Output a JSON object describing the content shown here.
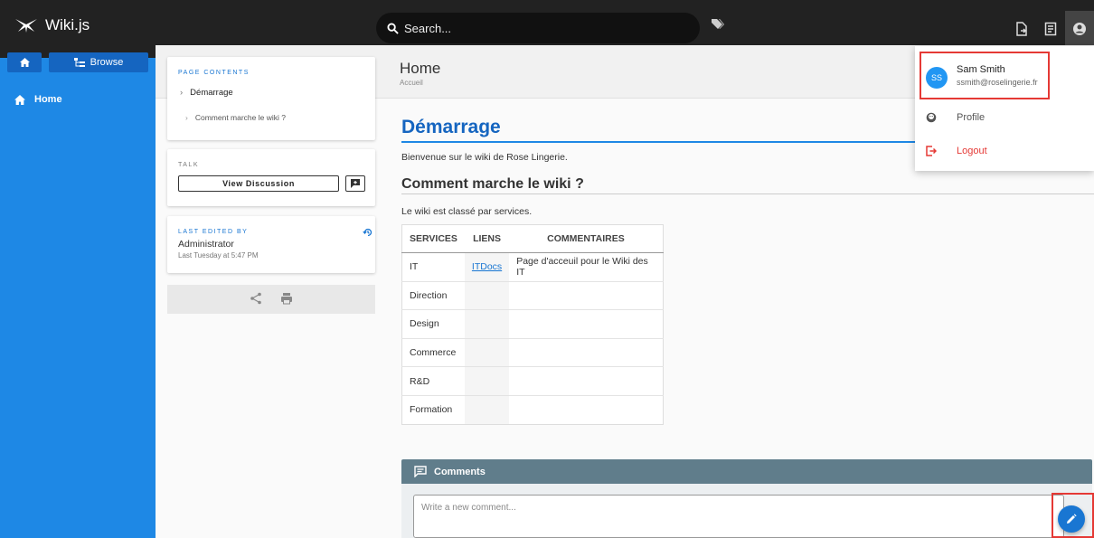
{
  "app": {
    "name": "Wiki.js"
  },
  "search": {
    "placeholder": "Search..."
  },
  "sidebar": {
    "browse_label": "Browse",
    "items": [
      {
        "label": "Home"
      }
    ]
  },
  "toc": {
    "label": "PAGE CONTENTS",
    "items": [
      {
        "label": "Démarrage",
        "level": 1
      },
      {
        "label": "Comment marche le wiki ?",
        "level": 2
      }
    ]
  },
  "talk": {
    "label": "TALK",
    "button": "View Discussion"
  },
  "last_edited": {
    "label": "LAST EDITED BY",
    "author": "Administrator",
    "when": "Last Tuesday at 5:47 PM"
  },
  "page": {
    "title": "Home",
    "subtitle": "Accueil",
    "h1": "Démarrage",
    "intro": "Bienvenue sur le wiki de Rose Lingerie.",
    "h2": "Comment marche le wiki ?",
    "p2": "Le wiki est classé par services."
  },
  "table": {
    "headers": [
      "SERVICES",
      "LIENS",
      "COMMENTAIRES"
    ],
    "rows": [
      [
        "IT",
        "ITDocs",
        "Page d'acceuil pour le Wiki des IT"
      ],
      [
        "Direction",
        "",
        ""
      ],
      [
        "Design",
        "",
        ""
      ],
      [
        "Commerce",
        "",
        ""
      ],
      [
        "R&D",
        "",
        ""
      ],
      [
        "Formation",
        "",
        ""
      ]
    ]
  },
  "comments": {
    "title": "Comments",
    "placeholder": "Write a new comment..."
  },
  "user_menu": {
    "initials": "SS",
    "name": "Sam Smith",
    "email": "ssmith@roselingerie.fr",
    "profile": "Profile",
    "logout": "Logout"
  },
  "colors": {
    "sidebar": "#1e88e5",
    "accent": "#1565c0",
    "danger": "#e53935",
    "comments_bar": "#607d8b"
  }
}
